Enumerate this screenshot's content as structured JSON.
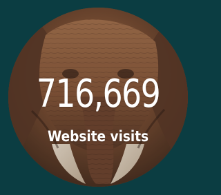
{
  "stat": {
    "value": "716,669",
    "label": "Website visits"
  },
  "image": {
    "subject": "elephant",
    "icon": "elephant-photo"
  },
  "colors": {
    "background": "#0b3d42",
    "text": "#ffffff",
    "photo_tone": "#8b5b3e"
  }
}
